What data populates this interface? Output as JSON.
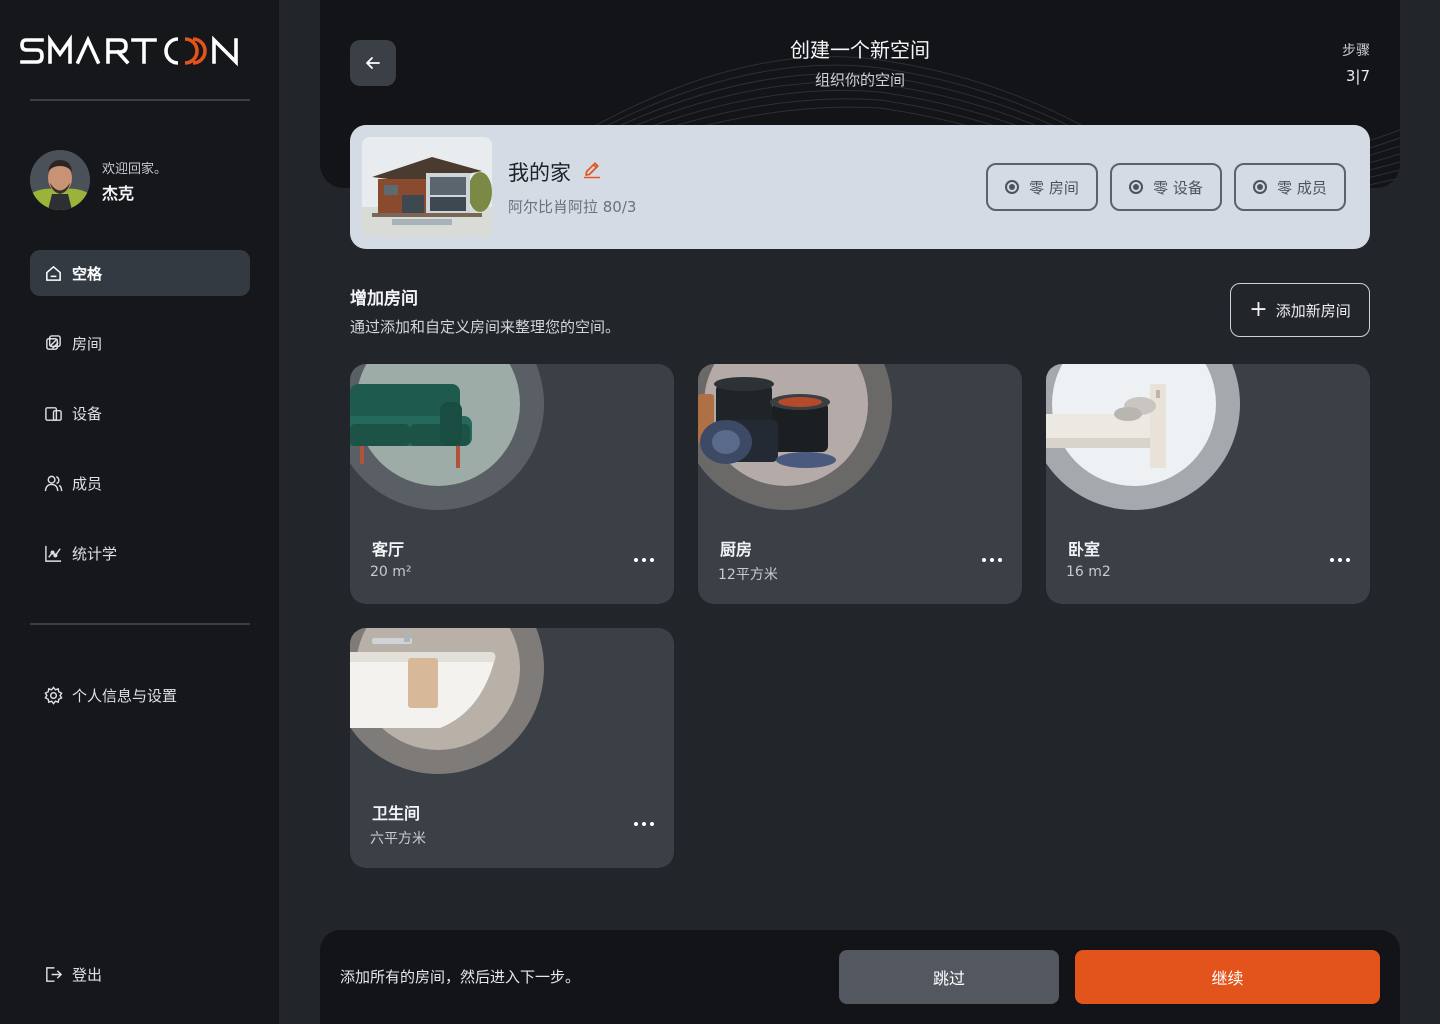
{
  "brand": {
    "logo_text": "SMARTOON",
    "accent_color": "#e3541c"
  },
  "user": {
    "welcome": "欢迎回家。",
    "name": "杰克"
  },
  "nav": {
    "items": [
      {
        "label": "空格",
        "icon": "home-icon",
        "active": true
      },
      {
        "label": "房间",
        "icon": "room-icon"
      },
      {
        "label": "设备",
        "icon": "devices-icon"
      },
      {
        "label": "成员",
        "icon": "members-icon"
      },
      {
        "label": "统计学",
        "icon": "statistics-icon"
      }
    ],
    "settings": {
      "label": "个人信息与设置",
      "icon": "gear-icon"
    },
    "logout": {
      "label": "登出",
      "icon": "logout-icon"
    }
  },
  "header": {
    "title": "创建一个新空间",
    "subtitle": "组织你的空间",
    "step_label": "步骤",
    "step_value": "3|7"
  },
  "space": {
    "name": "我的家",
    "address": "阿尔比肖阿拉 80/3",
    "chips": [
      {
        "label": "零 房间"
      },
      {
        "label": "零 设备"
      },
      {
        "label": "零 成员"
      }
    ]
  },
  "rooms_section": {
    "title": "增加房间",
    "description": "通过添加和自定义房间来整理您的空间。",
    "add_button": "添加新房间"
  },
  "rooms": [
    {
      "name": "客厅",
      "size": "20 m²",
      "image": "sofa-image"
    },
    {
      "name": "厨房",
      "size": "12平方米",
      "image": "cookware-image"
    },
    {
      "name": "卧室",
      "size": "16 m2",
      "image": "bed-image"
    },
    {
      "name": "卫生间",
      "size": "六平方米",
      "image": "bathtub-image"
    }
  ],
  "footer": {
    "text": "添加所有的房间，然后进入下一步。",
    "skip_label": "跳过",
    "continue_label": "继续"
  }
}
